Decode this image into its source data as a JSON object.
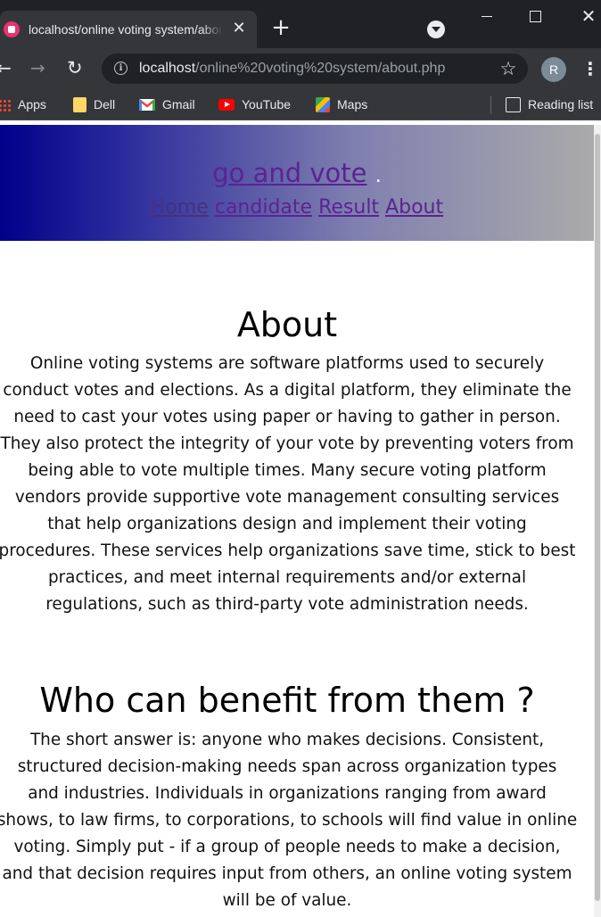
{
  "browser": {
    "tab": {
      "title": "localhost/online voting system/about.php"
    },
    "new_tab_symbol": "+",
    "close_symbol": "✕",
    "address": {
      "host": "localhost",
      "path": "/online%20voting%20system/about.php"
    },
    "profile_initial": "R",
    "bookmarks": [
      {
        "label": "Apps",
        "icon": "apps-icon"
      },
      {
        "label": "Dell",
        "icon": "folder-icon"
      },
      {
        "label": "Gmail",
        "icon": "gmail-icon"
      },
      {
        "label": "YouTube",
        "icon": "youtube-icon"
      },
      {
        "label": "Maps",
        "icon": "maps-icon"
      }
    ],
    "reading_list": "Reading list"
  },
  "site": {
    "brand": "go and vote",
    "brand_dot": ".",
    "nav": [
      "Home",
      "candidate",
      "Result",
      "About"
    ],
    "link_color": "#5b2392",
    "header_gradient": [
      "#00008b",
      "#aaaaaa"
    ]
  },
  "about": {
    "title": "About",
    "lines": [
      "Online voting systems are software platforms used to securely",
      "conduct votes and elections. As a digital platform, they eliminate the",
      "need to cast your votes using paper or having to gather in person.",
      "They also protect the integrity of your vote by preventing voters from",
      "being able to vote multiple times. Many secure voting platform",
      "vendors provide supportive vote management consulting services",
      "that help organizations design and implement their voting",
      "procedures. These services help organizations save time, stick to best",
      "practices, and meet internal requirements and/or external",
      "regulations, such as third-party vote administration needs."
    ]
  },
  "who": {
    "title": "Who can benefit from them ?",
    "lines": [
      "The short answer is: anyone who makes decisions. Consistent,",
      "structured decision-making needs span across organization types",
      "and industries. Individuals in organizations ranging from award",
      "shows, to law firms, to corporations, to schools will find value in online",
      "voting. Simply put - if a group of people needs to make a decision,",
      "and that decision requires input from others, an online voting system",
      "will be of value."
    ]
  }
}
